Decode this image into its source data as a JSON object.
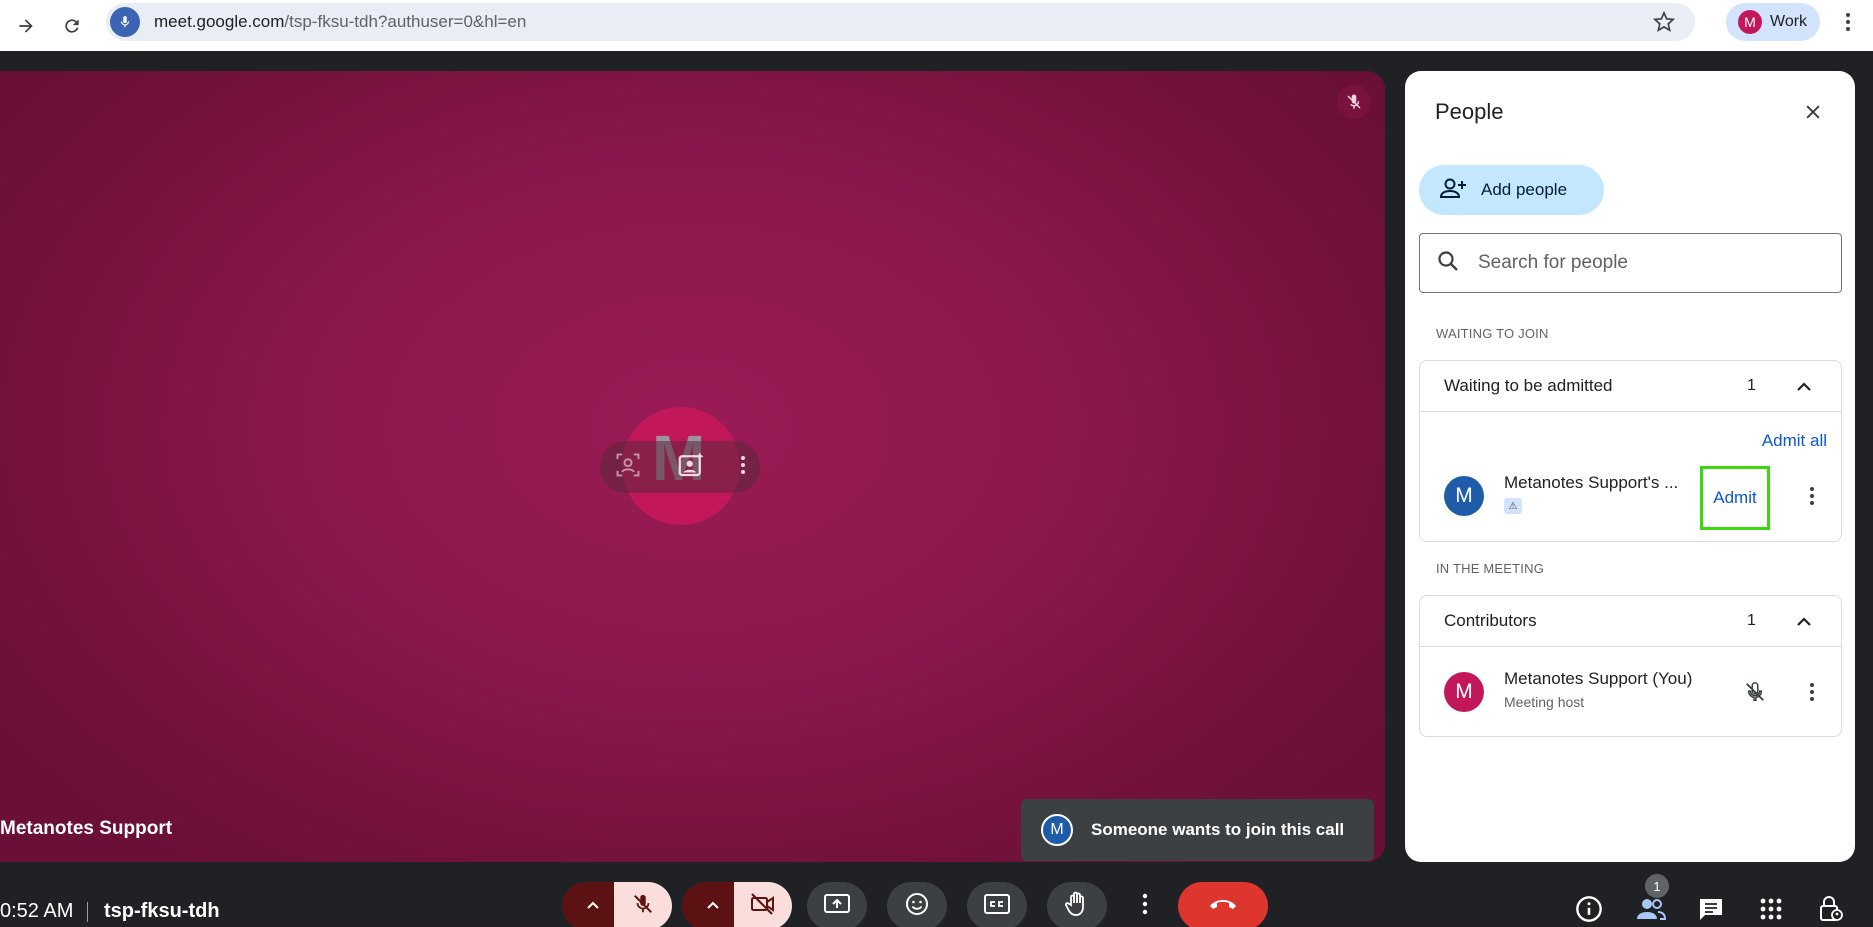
{
  "browser": {
    "url_host": "meet.google.com",
    "url_path": "/tsp-fksu-tdh?authuser=0&hl=en",
    "profile_initial": "M",
    "profile_name": "Work"
  },
  "video": {
    "participant_name": "Metanotes Support",
    "avatar_letter": "M",
    "tile_color": "#8c174c"
  },
  "toast": {
    "avatar_initial": "M",
    "message": "Someone wants to join this call"
  },
  "people_panel": {
    "title": "People",
    "add_people_label": "Add people",
    "search_placeholder": "Search for people",
    "waiting_section_label": "WAITING TO JOIN",
    "waiting_group": {
      "title": "Waiting to be admitted",
      "count": "1",
      "admit_all_label": "Admit all",
      "people": [
        {
          "initial": "M",
          "name": "Metanotes Support's ...",
          "admit_label": "Admit",
          "avatar_color": "#1e5ba8"
        }
      ]
    },
    "meeting_section_label": "IN THE MEETING",
    "contributors_group": {
      "title": "Contributors",
      "count": "1",
      "people": [
        {
          "initial": "M",
          "name": "Metanotes Support (You)",
          "role": "Meeting host",
          "avatar_color": "#c2185b"
        }
      ]
    }
  },
  "bottom_bar": {
    "time": "0:52 AM",
    "meeting_code": "tsp-fksu-tdh",
    "people_badge_count": "1"
  },
  "colors": {
    "accent_blue": "#0b57d0",
    "leave_red": "#dc362e",
    "admit_highlight": "#3ad80d"
  }
}
